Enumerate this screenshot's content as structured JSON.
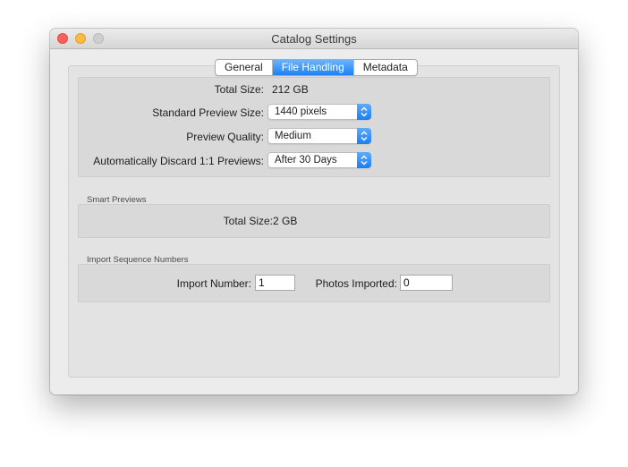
{
  "window": {
    "title": "Catalog Settings"
  },
  "tabs": [
    {
      "label": "General",
      "active": false
    },
    {
      "label": "File Handling",
      "active": true
    },
    {
      "label": "Metadata",
      "active": false
    }
  ],
  "preview_cache": {
    "total_size_label": "Total Size:",
    "total_size_value": "212 GB",
    "standard_preview_size_label": "Standard Preview Size:",
    "standard_preview_size_value": "1440 pixels",
    "preview_quality_label": "Preview Quality:",
    "preview_quality_value": "Medium",
    "discard_label": "Automatically Discard 1:1 Previews:",
    "discard_value": "After 30 Days"
  },
  "smart_previews": {
    "section_title": "Smart Previews",
    "total_size_label": "Total Size:",
    "total_size_value": "2 GB"
  },
  "import_sequence": {
    "section_title": "Import Sequence Numbers",
    "import_number_label": "Import Number:",
    "import_number_value": "1",
    "photos_imported_label": "Photos Imported:",
    "photos_imported_value": "0"
  },
  "colors": {
    "accent": "#1a82f7",
    "close": "#fc605c",
    "minimize": "#fdbc40",
    "zoom": "#cfcfcf"
  }
}
